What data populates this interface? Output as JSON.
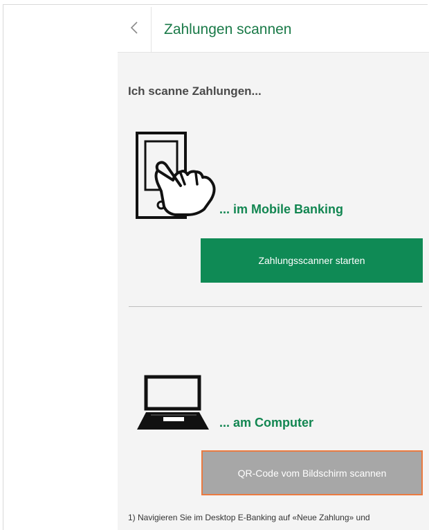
{
  "header": {
    "back_icon": "chevron-left-icon",
    "title": "Zahlungen scannen"
  },
  "intro": "Ich scanne Zahlungen...",
  "mobile": {
    "icon": "phone-hand-icon",
    "label": "... im Mobile Banking",
    "button_label": "Zahlungsscanner starten"
  },
  "computer": {
    "icon": "laptop-icon",
    "label": "... am Computer",
    "button_label": "QR-Code vom Bildschirm scannen"
  },
  "footnote": "1) Navigieren Sie im Desktop E-Banking auf «Neue Zahlung» und",
  "colors": {
    "brand_green": "#0f8a55",
    "title_green": "#1a7a48",
    "highlight_orange": "#ea7a40",
    "disabled_gray": "#a7a7a7"
  }
}
